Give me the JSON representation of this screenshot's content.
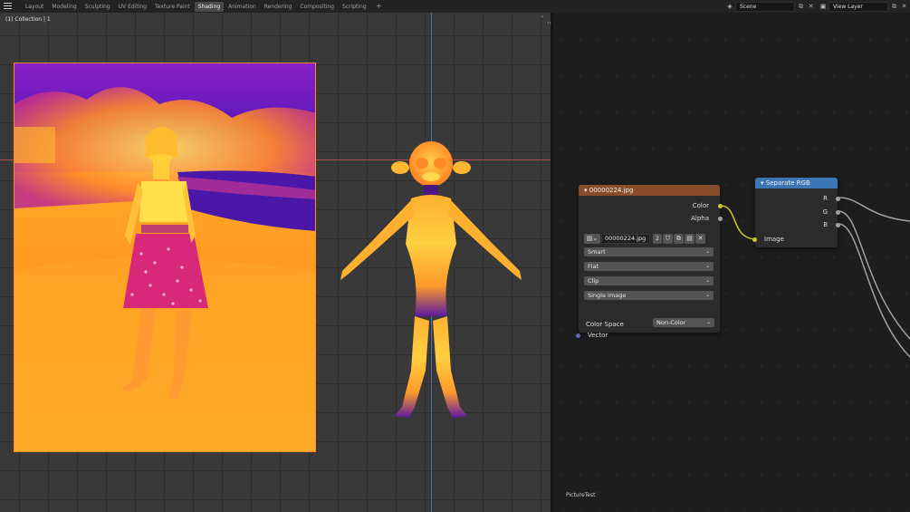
{
  "topbar": {
    "tabs": [
      "Layout",
      "Modeling",
      "Sculpting",
      "UV Editing",
      "Texture Paint",
      "Shading",
      "Animation",
      "Rendering",
      "Compositing",
      "Scripting"
    ],
    "active_tab": "Shading",
    "add_tab": "+",
    "scene_name": "Scene",
    "view_layer_name": "View Layer"
  },
  "viewport": {
    "collection_label": "(1) Collection | 1"
  },
  "node_editor": {
    "tree_name": "PictureTest",
    "image_node": {
      "title": "00000224.jpg",
      "outputs": [
        "Color",
        "Alpha"
      ],
      "image_name": "00000224.jpg",
      "users": "2",
      "interpolation": "Smart",
      "projection": "Flat",
      "extension": "Clip",
      "source": "Single Image",
      "color_space_label": "Color Space",
      "color_space": "Non-Color",
      "input": "Vector"
    },
    "separate_node": {
      "title": "Separate RGB",
      "outputs": [
        "R",
        "G",
        "B"
      ],
      "input": "Image"
    }
  },
  "colors": {
    "image_node_header": "#8a4d2b",
    "separate_node_header": "#3b75b4",
    "socket_color": "#c7c729",
    "socket_float": "#a1a1a1",
    "socket_vector": "#6363c7",
    "x_axis": "#b34a54",
    "z_axis": "#4a6ca8"
  }
}
